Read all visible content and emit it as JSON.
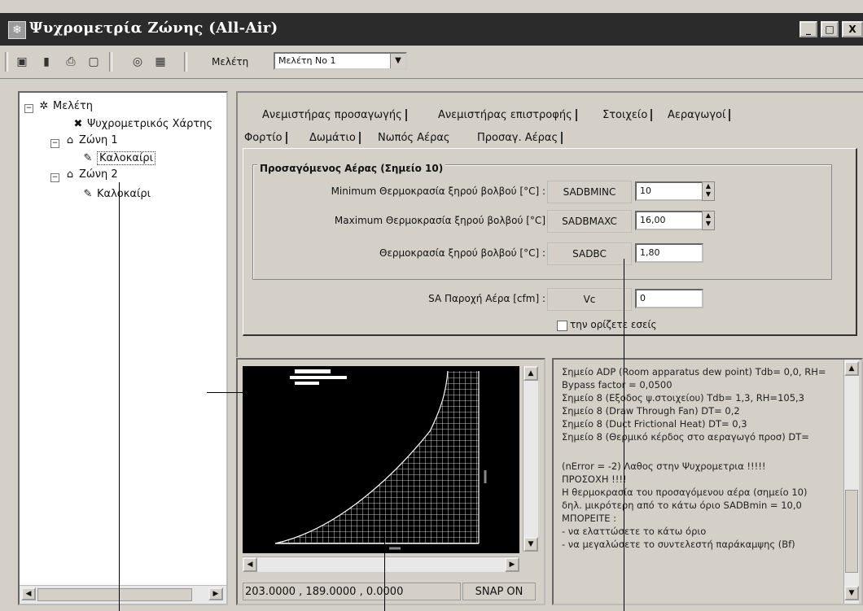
{
  "window": {
    "title": "Ψυχρομετρία Ζώνης (All-Air)",
    "title_icon": "snowflake-icon",
    "controls": [
      "_",
      "□",
      "X"
    ]
  },
  "toolbar": {
    "icons": [
      "save-icon",
      "book-icon",
      "print-icon",
      "page-icon",
      "disc-icon",
      "grid-icon"
    ],
    "study_label": "Μελέτη",
    "study_value": "Μελέτη Νο 1"
  },
  "tree": {
    "root": "Μελέτη",
    "chart": "Ψυχρομετρικός Χάρτης",
    "zone1": "Ζώνη 1",
    "zone1_child": "Καλοκαίρι",
    "zone2": "Ζώνη 2",
    "zone2_child": "Καλοκαίρι"
  },
  "tabs": {
    "row1": [
      "Ανεμιστήρας προσαγωγής",
      "Ανεμιστήρας επιστροφής",
      "Στοιχείο",
      "Αεραγωγοί"
    ],
    "row2": [
      "Φορτίο",
      "Δωμάτιο",
      "Νωπός Αέρας",
      "Προσαγ. Αέρας"
    ],
    "selected": "Προσαγ. Αέρας"
  },
  "supply_air": {
    "group_title": "Προσαγόμενος Αέρας  (Σημείο 10)",
    "rows": [
      {
        "label": "Minimum Θερμοκρασία ξηρού βολβού  [°C] :",
        "code": "SADBMINC",
        "value": "10"
      },
      {
        "label": "Maximum Θερμοκρασία ξηρού βολβού  [°C]",
        "code": "SADBMAXC",
        "value": "16,00"
      },
      {
        "label": "Θερμοκρασία ξηρού βολβού  [°C] :",
        "code": "SADBC",
        "value": "1,80"
      }
    ],
    "flow_label": "SA Παροχή Αέρα  [cfm] :",
    "flow_code": "Vc",
    "flow_value": "0",
    "checkbox_label": "την ορίζετε εσείς"
  },
  "plot": {
    "coords": "203.0000 , 189.0000 , 0.0000",
    "snap": "SNAP ON"
  },
  "messages": [
    "Σημείο ADP (Room apparatus dew point) Tdb= 0,0, RH=",
    "Bypass factor = 0,0500",
    "Σημείο 8 (Εξοδος ψ.στοιχείου) Tdb= 1,3, RH=105,3",
    "Σημείο 8 (Draw Through Fan) DT= 0,2",
    "Σημείο 8 (Duct Frictional Heat) DT= 0,3",
    "Σημείο 8 (Θερμικό κέρδος στο αεραγωγό προσ) DT=",
    "",
    "(nError = -2) Λαθος στην Ψυχρομετρια  !!!!!",
    "                    ΠΡΟΣΟΧΗ !!!!",
    "Η θερμοκρασία του προσαγόμενου αέρα (σημείο 10)",
    "δηλ. μικρότερη από το κάτω όριο  SADBmin = 10,0",
    " ΜΠΟΡΕΙΤΕ :",
    " - να ελαττώσετε το κάτω όριο",
    " - να μεγαλώσετε το συντελεστή παράκαμψης (Bf)"
  ]
}
